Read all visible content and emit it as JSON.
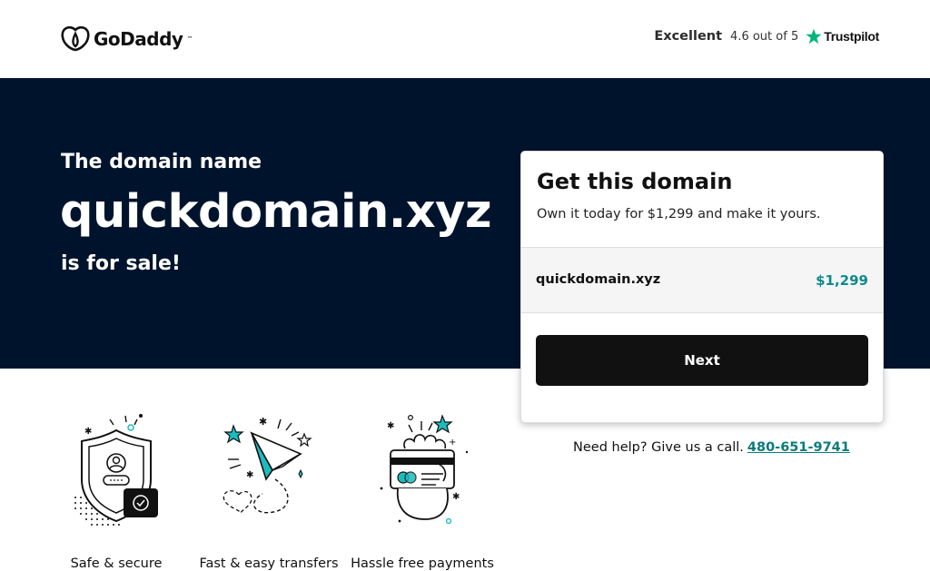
{
  "header": {
    "logo_text": "GoDaddy",
    "rating_label": "Excellent",
    "rating_score": "4.6 out of 5",
    "rating_provider": "Trustpilot"
  },
  "hero": {
    "lead": "The domain name",
    "domain": "quickdomain.xyz",
    "suffix": "is for sale!"
  },
  "card": {
    "title": "Get this domain",
    "subtitle": "Own it today for $1,299 and make it yours.",
    "domain": "quickdomain.xyz",
    "price": "$1,299",
    "next_label": "Next"
  },
  "help": {
    "text": "Need help? Give us a call.",
    "phone": "480-651-9741"
  },
  "features": [
    {
      "label": "Safe & secure",
      "icon": "shield-icon"
    },
    {
      "label": "Fast & easy transfers",
      "icon": "paper-plane-icon"
    },
    {
      "label": "Hassle free payments",
      "icon": "credit-card-hand-icon"
    }
  ],
  "colors": {
    "hero_bg": "#00132d",
    "accent_teal": "#0f8a8a",
    "button_bg": "#111111",
    "trustpilot_green": "#00b67a",
    "icon_teal": "#1bbcc0"
  }
}
